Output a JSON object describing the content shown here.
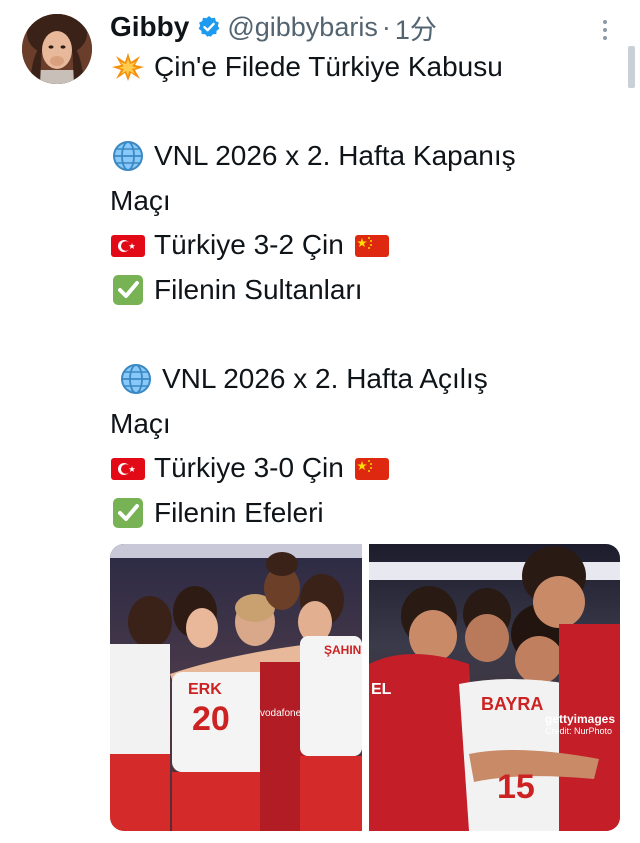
{
  "tweet": {
    "display_name": "Gibby",
    "handle": "@gibbybaris",
    "separator": "·",
    "time": "1分",
    "icons": {
      "verified": "verified-badge-icon",
      "more": "more-options-icon",
      "collision": "collision-emoji-icon",
      "globe": "globe-emoji-icon",
      "turkey_flag": "turkey-flag-icon",
      "china_flag": "china-flag-icon",
      "check": "check-mark-emoji-icon"
    },
    "lines": {
      "title": "Çin'e Filede Türkiye Kabusu",
      "match1_line1": "VNL 2026 x 2. Hafta Kapanış",
      "match1_line2": "Maçı",
      "match1_score": "Türkiye 3-2 Çin",
      "match1_team": "Filenin Sultanları",
      "match2_line1": "VNL 2026 x 2. Hafta Açılış",
      "match2_line2": "Maçı",
      "match2_score": "Türkiye 3-0 Çin",
      "match2_team": "Filenin Efeleri"
    },
    "media": {
      "left_jersey_name": "ERK",
      "left_jersey_number": "20",
      "left_jersey_name_2": "ŞAHIN",
      "left_sponsor": "vodafone",
      "right_jersey_name": "BAYRA",
      "right_jersey_name_2": "EL",
      "right_jersey_number": "15",
      "watermark_brand": "gettyimages",
      "watermark_credit": "Credit: NurPhoto"
    }
  },
  "colors": {
    "text": "#0f1419",
    "secondary": "#536471",
    "verified": "#1d9bf0",
    "turkey_red": "#e30a17",
    "china_red": "#de2910",
    "china_yellow": "#ffde00",
    "check_green": "#77b255"
  }
}
